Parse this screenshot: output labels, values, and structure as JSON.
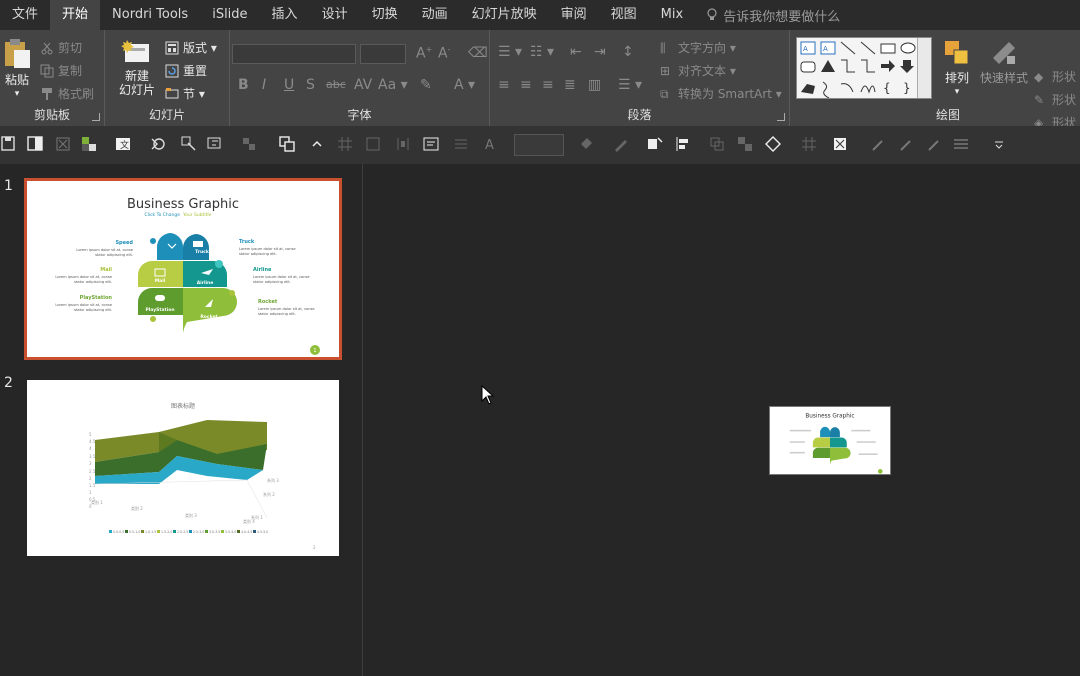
{
  "menu": {
    "tabs": [
      "文件",
      "开始",
      "Nordri Tools",
      "iSlide",
      "插入",
      "设计",
      "切换",
      "动画",
      "幻灯片放映",
      "审阅",
      "视图",
      "Mix"
    ],
    "active": "开始",
    "tell_me": "告诉我你想要做什么"
  },
  "ribbon": {
    "clipboard": {
      "label": "剪贴板",
      "paste": "粘贴",
      "cut": "剪切",
      "copy": "复制",
      "format_painter": "格式刷"
    },
    "slides": {
      "label": "幻灯片",
      "new_slide": "新建",
      "new_slide2": "幻灯片",
      "layout": "版式",
      "reset": "重置",
      "section": "节"
    },
    "font": {
      "label": "字体"
    },
    "paragraph": {
      "label": "段落",
      "text_direction": "文字方向",
      "align_text": "对齐文本",
      "smartart": "转换为 SmartArt"
    },
    "drawing": {
      "label": "绘图",
      "arrange": "排列",
      "quick_styles": "快速样式",
      "shape_fill": "形状",
      "shape_outline": "形状",
      "shape_effects": "形状"
    }
  },
  "slides": [
    {
      "number": "1",
      "title": "Business Graphic",
      "subtitle_a": "Click To Change",
      "subtitle_b": "Your Subtitle",
      "left_items": [
        "Speed",
        "Mail",
        "PlayStation"
      ],
      "right_items": [
        "Truck",
        "Airline",
        "Rocket"
      ],
      "petals": [
        "Truck",
        "Mail",
        "Airline",
        "PlayStation",
        "Rocket"
      ],
      "lorem": "Lorem ipsum dolor sit at, conse",
      "lorem2": "statur adipiscing elit.",
      "page": "1"
    },
    {
      "number": "2",
      "title": "图表标题",
      "yticks": [
        "5",
        "4.5",
        "4",
        "3.5",
        "3",
        "2.5",
        "2",
        "1.5",
        "1",
        "0.5",
        "0"
      ],
      "categories": [
        "类别 1",
        "类别 2",
        "类别 3",
        "类别 4"
      ],
      "series_labels": [
        "系列 1",
        "系列 2",
        "系列 3"
      ],
      "legend": [
        "0.0-0.5",
        "0.5-1.0",
        "1.0-1.5",
        "1.5-2.0",
        "2.0-2.5",
        "2.5-3.0",
        "3.0-3.5",
        "3.5-4.0",
        "4.0-4.5",
        "4.5-5.0"
      ],
      "page": "2"
    }
  ],
  "colors": {
    "accent": "#c8502f",
    "blue": "#1d8fb8",
    "teal": "#13978e",
    "lime": "#a9c33a",
    "green": "#6ea534"
  }
}
